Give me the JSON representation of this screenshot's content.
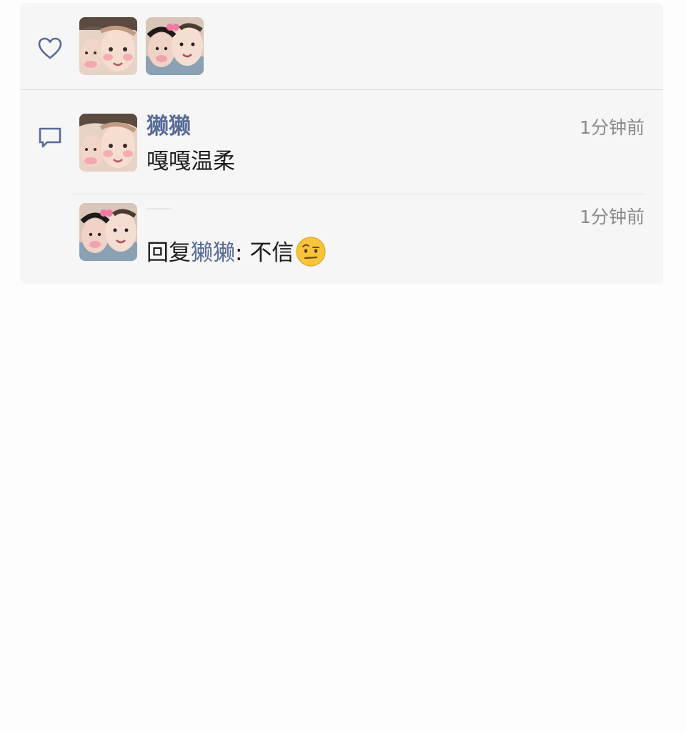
{
  "likes": {
    "icon": "heart-icon",
    "avatars": [
      {
        "name": "like-avatar-1"
      },
      {
        "name": "like-avatar-2"
      }
    ]
  },
  "comments": [
    {
      "username": "獭獭",
      "text": "嘎嘎温柔",
      "time": "1分钟前"
    },
    {
      "reply_prefix": "回复",
      "reply_to": "獭獭",
      "separator": ": ",
      "text": "不信",
      "emoji": "raised-eyebrow-emoji",
      "time": "1分钟前"
    }
  ],
  "colors": {
    "link": "#576b95",
    "card_bg": "#f6f6f6",
    "text": "#1d1d1d",
    "time": "#8a8a8a"
  }
}
